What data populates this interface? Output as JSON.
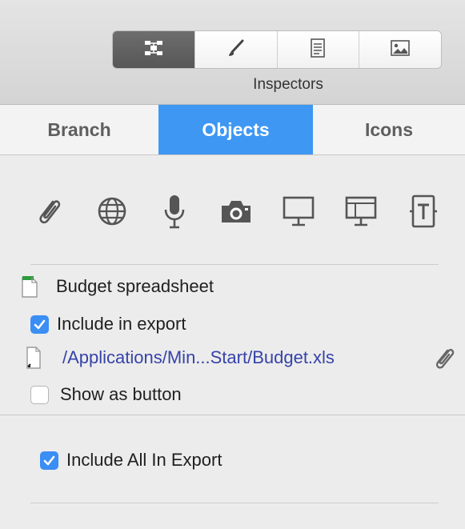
{
  "toolbar": {
    "segments": [
      {
        "icon": "grid-icon",
        "active": true
      },
      {
        "icon": "brush-icon",
        "active": false
      },
      {
        "icon": "document-icon",
        "active": false
      },
      {
        "icon": "image-icon",
        "active": false
      }
    ],
    "label": "Inspectors"
  },
  "tabs": [
    {
      "label": "Branch",
      "active": false
    },
    {
      "label": "Objects",
      "active": true
    },
    {
      "label": "Icons",
      "active": false
    }
  ],
  "object_icons": [
    "paperclip-icon",
    "globe-icon",
    "microphone-icon",
    "camera-icon",
    "monitor-icon",
    "screen-recording-icon",
    "text-box-icon"
  ],
  "attachment": {
    "name": "Budget spreadsheet",
    "include_in_export": {
      "label": "Include in export",
      "checked": true
    },
    "path": "/Applications/Min...Start/Budget.xls",
    "show_as_button": {
      "label": "Show as button",
      "checked": false
    }
  },
  "include_all": {
    "label": "Include All In Export",
    "checked": true
  },
  "colors": {
    "accent": "#3d97f3",
    "checkbox": "#3a8ef4",
    "path_link": "#3643a8"
  }
}
